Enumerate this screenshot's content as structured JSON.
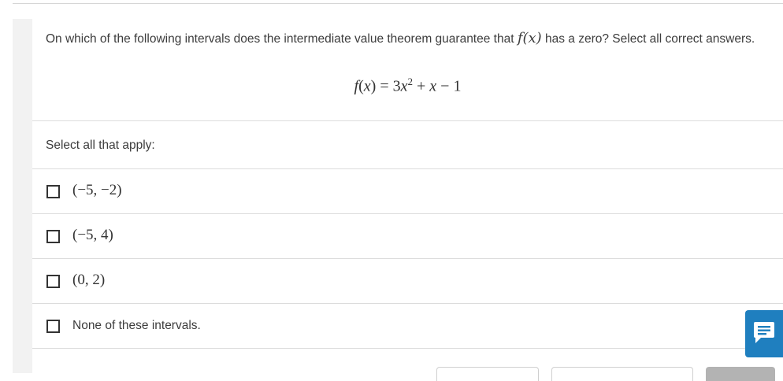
{
  "question": {
    "prefix": "On which of the following intervals does the intermediate value theorem guarantee that ",
    "inline_function": "f(x)",
    "suffix": " has a zero? Select all correct answers.",
    "formula": "f(x) = 3x² + x − 1"
  },
  "instruction": "Select all that apply:",
  "options": [
    {
      "label": "(−5, −2)",
      "checked": false
    },
    {
      "label": "(−5, 4)",
      "checked": false
    },
    {
      "label": "(0, 2)",
      "checked": false
    },
    {
      "label": "None of these intervals.",
      "checked": false
    }
  ],
  "icons": {
    "chat": "chat-bubble-icon"
  },
  "colors": {
    "accent": "#1f7fbf",
    "border": "#dcdcdc",
    "text": "#3c3c3c"
  }
}
